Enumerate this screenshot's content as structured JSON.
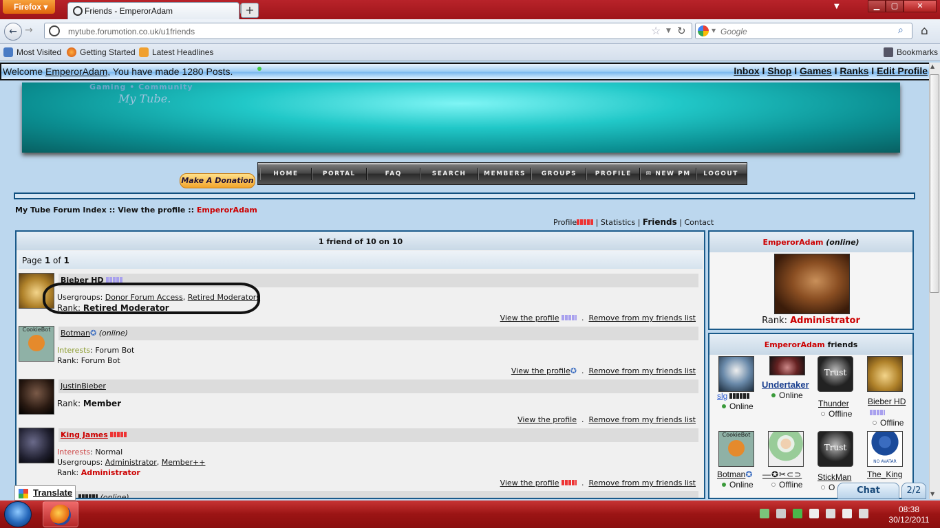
{
  "browser": {
    "app_button": "Firefox",
    "tab_title": "Friends - EmperorAdam",
    "url": "mytube.forumotion.co.uk/u1friends",
    "search_placeholder": "Google",
    "bookmarks": [
      "Most Visited",
      "Getting Started",
      "Latest Headlines"
    ],
    "bookmarks_menu": "Bookmarks"
  },
  "welcome": {
    "prefix": "Welcome ",
    "user": "EmperorAdam",
    "suffix": ", You have made 1280 Posts.",
    "links": [
      "Inbox",
      "Shop",
      "Games",
      "Ranks",
      "Edit Profile"
    ]
  },
  "banner": {
    "line1": "Gaming • Community",
    "line2": "My Tube."
  },
  "donate_label": "Make A Donation",
  "menu": [
    "HOME",
    "PORTAL",
    "FAQ",
    "SEARCH",
    "MEMBERS",
    "GROUPS",
    "PROFILE",
    "NEW PM",
    "LOGOUT"
  ],
  "breadcrumb": {
    "path": "My Tube Forum Index :: View the profile :: ",
    "user": "EmperorAdam"
  },
  "profile_tabs": [
    "Profile",
    "Statistics",
    "Friends",
    "Contact"
  ],
  "friends_header": "1 friend of 10 on 10",
  "pagination": {
    "prefix": "Page ",
    "current": "1",
    "middle": " of ",
    "total": "1"
  },
  "friends": [
    {
      "name": "Bieber HD",
      "usergroups_label": "Usergroups",
      "usergroups": [
        "Donor Forum Access",
        "Retired Moderators"
      ],
      "rank_label": "Rank",
      "rank": "Retired Moderator",
      "view": "View the profile",
      "remove": "Remove from my friends list"
    },
    {
      "name": "Botman",
      "status": "(online)",
      "interests_label": "Interests",
      "interests": "Forum Bot",
      "rank_label": "Rank",
      "rank": "Forum Bot",
      "avatar_text": "CookieBot",
      "view": "View the profile",
      "remove": "Remove from my friends list"
    },
    {
      "name": "JustinBieber",
      "rank_label": "Rank",
      "rank": "Member",
      "view": "View the profile",
      "remove": "Remove from my friends list"
    },
    {
      "name": "King James",
      "interests_label": "Interests",
      "interests": "Normal",
      "usergroups_label": "Usergroups",
      "usergroups": [
        "Administrator",
        "Member++"
      ],
      "rank_label": "Rank",
      "rank": "Administrator",
      "view": "View the profile",
      "remove": "Remove from my friends list"
    },
    {
      "status": "(online)"
    }
  ],
  "profile_card": {
    "user": "EmperorAdam",
    "status": "(online)",
    "rank_label": "Rank: ",
    "rank": "Administrator"
  },
  "friends_card": {
    "user": "EmperorAdam",
    "label": " friends"
  },
  "friend_grid": [
    {
      "name": "slg",
      "status": "Online"
    },
    {
      "name": "Undertaker",
      "status": "Online"
    },
    {
      "name": "Thunder",
      "status": "Offline",
      "avatar_text": "Trust"
    },
    {
      "name": "Bieber HD",
      "status": "Offline"
    },
    {
      "name": "Botman",
      "status": "Online",
      "avatar_text": "CookieBot"
    },
    {
      "name": "—✪✂⊂⊃",
      "status": "Offline"
    },
    {
      "name": "StickMan",
      "status": "O",
      "avatar_text": "Trust"
    },
    {
      "name": "The_King",
      "avatar_text": "NO AVATAR"
    }
  ],
  "translate": "Translate",
  "chat": {
    "label": "Chat",
    "count": "2/2"
  },
  "clock": {
    "time": "08:38",
    "date": "30/12/2011"
  },
  "colors": {
    "red": "#cc0000",
    "blue_border": "#1a5a8a",
    "online": "#3a9a3a",
    "offline": "#999999"
  }
}
